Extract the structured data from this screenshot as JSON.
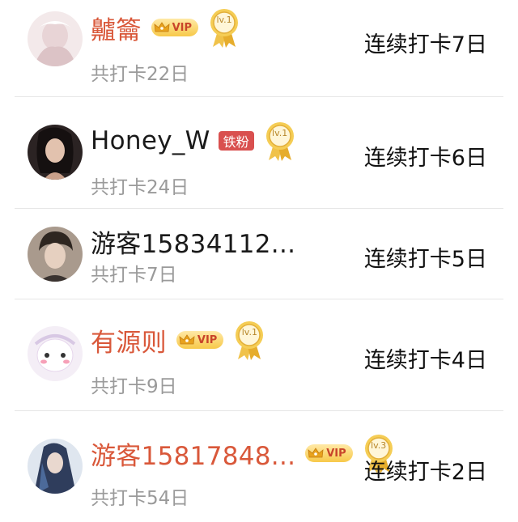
{
  "rows": [
    {
      "name": "齇籥",
      "name_style": "vip",
      "vip_label": "VIP",
      "fan_label": "",
      "level": "lv.1",
      "total": "共打卡22日",
      "streak": "连续打卡7日"
    },
    {
      "name": "Honey_W",
      "name_style": "normal",
      "vip_label": "",
      "fan_label": "铁粉",
      "level": "lv.1",
      "total": "共打卡24日",
      "streak": "连续打卡6日"
    },
    {
      "name": "游客15834112...",
      "name_style": "normal",
      "vip_label": "",
      "fan_label": "",
      "level": "",
      "total": "共打卡7日",
      "streak": "连续打卡5日"
    },
    {
      "name": "有源则",
      "name_style": "vip",
      "vip_label": "VIP",
      "fan_label": "",
      "level": "lv.1",
      "total": "共打卡9日",
      "streak": "连续打卡4日"
    },
    {
      "name": "游客15817848...",
      "name_style": "vip",
      "vip_label": "VIP",
      "fan_label": "",
      "level": "lv.3",
      "total": "共打卡54日",
      "streak": "连续打卡2日"
    }
  ],
  "colors": {
    "vip_name": "#d9583a",
    "normal_name": "#1a1a1a",
    "sub_text": "#9a9a9a",
    "fan_badge": "#d9504f"
  }
}
